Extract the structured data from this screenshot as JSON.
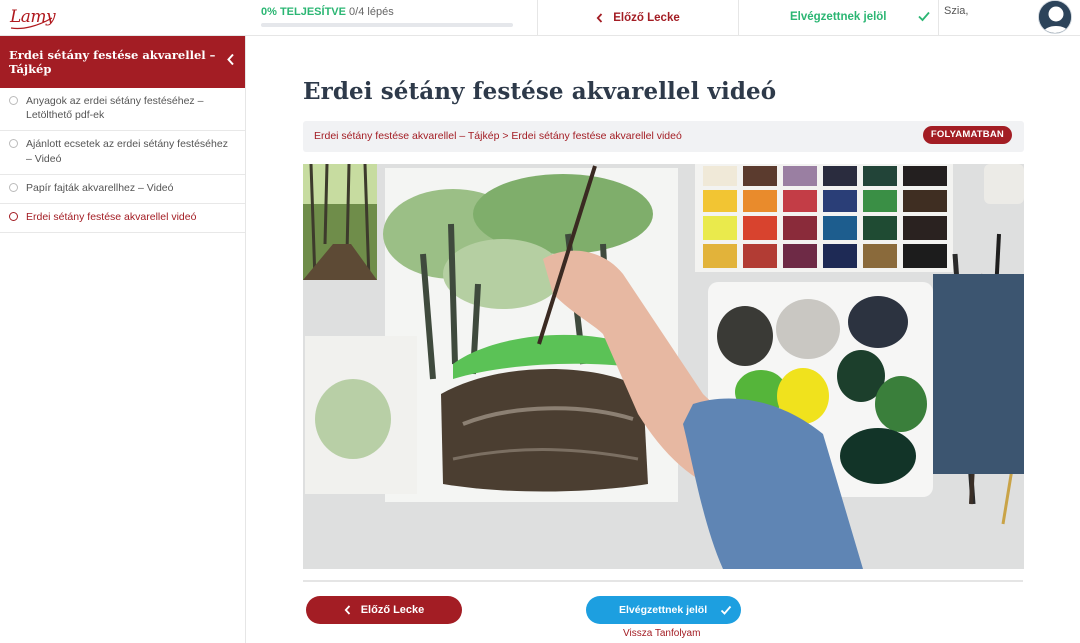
{
  "brand": {
    "logo_text": "Lamy"
  },
  "progress": {
    "percent_label": "0% TELJESÍTVE",
    "steps_label": "0/4 lépés",
    "fraction": 0
  },
  "topnav": {
    "prev_label": "Előző Lecke",
    "complete_label": "Elvégzettnek jelöl",
    "greeting": "Szia,"
  },
  "sidebar": {
    "course_title": "Erdei sétány festése akvarellel – Tájkép",
    "lessons": [
      {
        "label": "Anyagok az erdei sétány festéséhez – Letölthető pdf-ek",
        "active": false
      },
      {
        "label": "Ajánlott ecsetek az erdei sétány festéséhez – Videó",
        "active": false
      },
      {
        "label": "Papír fajták akvarellhez – Videó",
        "active": false
      },
      {
        "label": "Erdei sétány festése akvarellel videó",
        "active": true
      }
    ]
  },
  "main": {
    "title": "Erdei sétány festése akvarellel videó",
    "breadcrumb": {
      "course": "Erdei sétány festése akvarellel – Tájkép",
      "separator": ">",
      "lesson": "Erdei sétány festése akvarellel videó"
    },
    "status_badge": "FOLYAMATBAN"
  },
  "footer": {
    "prev_label": "Előző Lecke",
    "complete_label": "Elvégzettnek jelöl",
    "back_label": "Vissza Tanfolyam"
  },
  "colors": {
    "brand_red": "#a31d24",
    "success_green": "#2bb673",
    "action_blue": "#1d9fe0"
  }
}
